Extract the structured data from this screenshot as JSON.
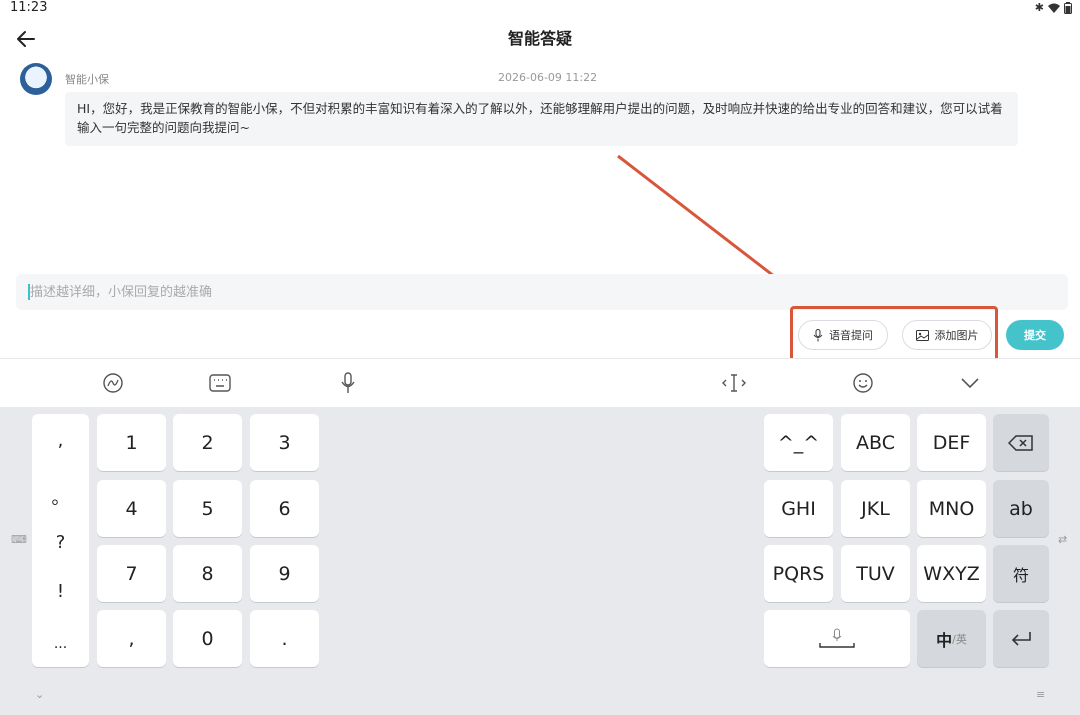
{
  "status_bar": {
    "time": "11:23"
  },
  "header": {
    "title": "智能答疑"
  },
  "chat": {
    "sender": "智能小保",
    "timestamp": "2026-06-09 11:22",
    "message": "HI，您好，我是正保教育的智能小保，不但对积累的丰富知识有着深入的了解以外，还能够理解用户提出的问题，及时响应并快速的给出专业的回答和建议，您可以试着输入一句完整的问题向我提问~"
  },
  "composer": {
    "placeholder": "描述越详细，小保回复的越准确",
    "voice_label": "语音提问",
    "image_label": "添加图片",
    "submit_label": "提交"
  },
  "keyboard": {
    "symbols": [
      ",",
      "。",
      "?",
      "!",
      "..."
    ],
    "numpad": [
      "1",
      "2",
      "3",
      "4",
      "5",
      "6",
      "7",
      "8",
      "9",
      ",",
      "0",
      "."
    ],
    "letters": [
      "^_^",
      "ABC",
      "DEF",
      "GHI",
      "JKL",
      "MNO",
      "PQRS",
      "TUV",
      "WXYZ"
    ],
    "ab_label": "ab",
    "symbol_key": "符",
    "lang_key_main": "中",
    "lang_key_alt": "/英"
  },
  "icons": [
    "back-arrow-icon",
    "bluetooth-icon",
    "wifi-icon",
    "battery-icon",
    "mic-icon",
    "image-icon",
    "handwriting-icon",
    "keyboard-icon",
    "cursor-icon",
    "emoji-icon",
    "chevron-down-icon",
    "backspace-icon",
    "enter-icon"
  ],
  "colors": {
    "accent": "#45c3cb",
    "annotation": "#d9563a"
  }
}
